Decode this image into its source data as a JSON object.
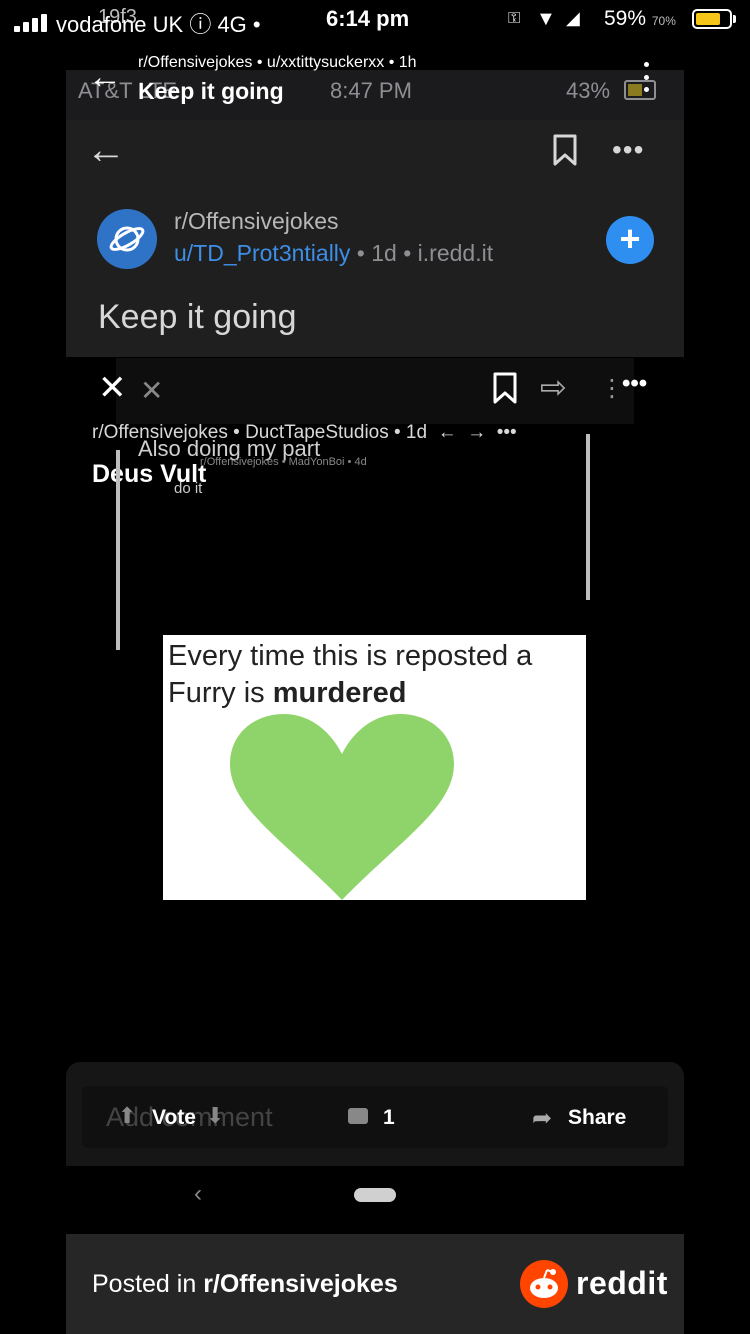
{
  "status_bar": {
    "carrier": "vodafone UK",
    "network": "4G",
    "overlay_text": "19f3",
    "time": "6:14 pm",
    "battery": "59%",
    "battery_overlay": "70%"
  },
  "outer_header": {
    "meta": "r/Offensivejokes • u/xxtittysuckerxx • 1h",
    "title": "Keep it going"
  },
  "inner_status": {
    "carrier": "AT&T LTE",
    "time": "8:47 PM",
    "battery": "43%"
  },
  "inner_post": {
    "subreddit": "r/Offensivejokes",
    "user": "u/TD_Prot3ntially",
    "meta_rest": " • 1d • i.redd.it",
    "title": "Keep it going"
  },
  "deep_post": {
    "meta": "r/Offensivejokes • DuctTapeStudios • 1d",
    "title": "Deus Vult",
    "overlay_title": "Also doing my part",
    "overlay_meta": "r/Offensivejokes • MadYonBoi • 4d",
    "overlay_sub": "do it"
  },
  "meme": {
    "line1": "Every time this is reposted a",
    "line2_prefix": "Furry is ",
    "line2_bold": "murdered",
    "heart_color": "#8fd46a"
  },
  "action_bar": {
    "add_comment_ghost": "Add comment",
    "vote_label": "Vote",
    "comment_count": "1",
    "share_label": "Share"
  },
  "footer": {
    "posted_prefix": "Posted in ",
    "subreddit": "r/Offensivejokes",
    "brand": "reddit",
    "brand_color": "#ff4500"
  },
  "icons": {
    "back": "back-arrow-icon",
    "bookmark": "bookmark-icon",
    "more": "more-dots-icon",
    "close": "close-icon",
    "share": "share-arrow-icon",
    "comment": "comment-icon",
    "upvote": "upvote-icon",
    "downvote": "downvote-icon"
  }
}
